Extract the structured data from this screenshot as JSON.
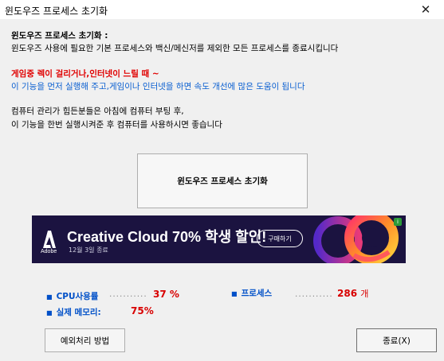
{
  "window": {
    "title": "윈도우즈 프로세스 초기화",
    "close_glyph": "✕"
  },
  "description": {
    "heading": "윈도우즈 프로세스 초기화 :",
    "line1": "윈도우즈 사용에 필요한 기본 프로세스와 백신/메신저를 제외한 모든 프로세스를 종료시킵니다",
    "warning": "게임중 렉이 걸리거나,인터넷이 느릴 때 ~",
    "tip": "이 기능을 먼저 실행해 주고,게임이나 인터넷을 하면 속도 개선에 많은 도움이 됩니다",
    "note1": "컴퓨터 관리가 힘든분들은 아침에 컴퓨터 부팅 후,",
    "note2": "이 기능을 한번 실행시켜준 후 컴퓨터를 사용하시면 좋습니다"
  },
  "main_button": {
    "label": "윈도우즈 프로세스 초기화"
  },
  "ad": {
    "brand": "Adobe",
    "headline": "Creative Cloud 70% 학생 할인!",
    "subtext": "12월 3일 종료",
    "cta": "구매하기",
    "info": "i"
  },
  "stats": {
    "cpu": {
      "label": "CPU사용률",
      "dots": "...........",
      "value": "37 %"
    },
    "memory": {
      "label": "실제 메모리:",
      "value": "75%"
    },
    "process": {
      "label": "프로세스",
      "dots": "...........",
      "value": "286",
      "unit": "개"
    }
  },
  "buttons": {
    "exception": "예외처리 방법",
    "exit": "종료(X)"
  },
  "colors": {
    "window_bg": "#f0f0f0",
    "accent_blue": "#0050c8",
    "warning_red": "#e00000",
    "ad_bg": "#1b1340"
  }
}
